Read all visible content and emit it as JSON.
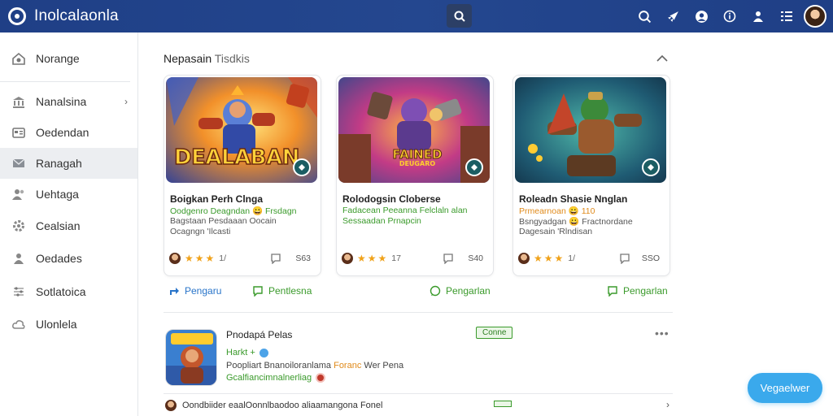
{
  "header": {
    "app_title": "Inolcalaonla",
    "icons": [
      "search-icon",
      "rocket-icon",
      "user-circle-icon",
      "info-icon",
      "person-icon",
      "grid-icon"
    ]
  },
  "sidebar": {
    "items": [
      {
        "label": "Norange",
        "icon": "home-settings-icon"
      },
      {
        "label": "Nanalsina",
        "icon": "bank-icon"
      },
      {
        "label": "Oedendan",
        "icon": "id-card-icon"
      },
      {
        "label": "Ranagah",
        "icon": "mail-icon"
      },
      {
        "label": "Uehtaga",
        "icon": "users-icon"
      },
      {
        "label": "Cealsian",
        "icon": "gear-icon"
      },
      {
        "label": "Oedades",
        "icon": "person-icon"
      },
      {
        "label": "Sotlatoica",
        "icon": "sliders-icon"
      },
      {
        "label": "Ulonlela",
        "icon": "cloud-icon"
      }
    ]
  },
  "section": {
    "title": "Nepasain",
    "subtitle": "Tisdkis"
  },
  "cards": [
    {
      "art_text": "DEALABAN",
      "title": "Boigkan Perh Clnga",
      "line1": "Oodgenro Deagndan 😀 Frsdagn",
      "line2": "Bagstaan Pesdaaan Oocain",
      "line3": "Ocagngn 'Ilcasti",
      "rating_value": "1/",
      "comment_count": "S63"
    },
    {
      "art_text": "FAINED",
      "art_sub": "DEUGARO",
      "title": "Rolodogsin Cloberse",
      "line1": "Fadacean Peeanna Felclaln alan",
      "line2": "Sessaadan Prnapcin",
      "line3": "",
      "rating_value": "17",
      "comment_count": "S40"
    },
    {
      "art_text": "",
      "title": "Roleadn Shasie Nnglan",
      "line1": "Prmearnoan 😀 110",
      "line2": "Bsngyadgan 😀 Fractnordane",
      "line3": "Dagesain 'Rlndisan",
      "rating_value": "1/",
      "comment_count": "SSO"
    }
  ],
  "actions": [
    {
      "label": "Pengaru",
      "color": "#2874c9"
    },
    {
      "label": "Pentlesna",
      "color": "#3a9a2b"
    },
    {
      "label": "Pengarlan",
      "color": "#3a9a2b"
    },
    {
      "label": "Pengarlan",
      "color": "#3a9a2b"
    }
  ],
  "featured": {
    "title": "Pnodapá Pelas",
    "chip": "Conne",
    "line1": "Harkt +",
    "line2_a": "Poopliart Bnanoiloranlama ",
    "line2_hl": "Foranc",
    "line2_b": " Wer Pena",
    "line3": "Gcalfiancimnalnerliag"
  },
  "bottom_row": {
    "text": "Oondbiider eaalOonnlbaodoo aliaamangona Fonel"
  },
  "fab": {
    "label": "Vegaelwer"
  },
  "colors": {
    "header_bg": "#1f3f86",
    "accent_green": "#3a9a2b",
    "accent_blue": "#2874c9",
    "fab_bg": "#3aa9ec"
  }
}
